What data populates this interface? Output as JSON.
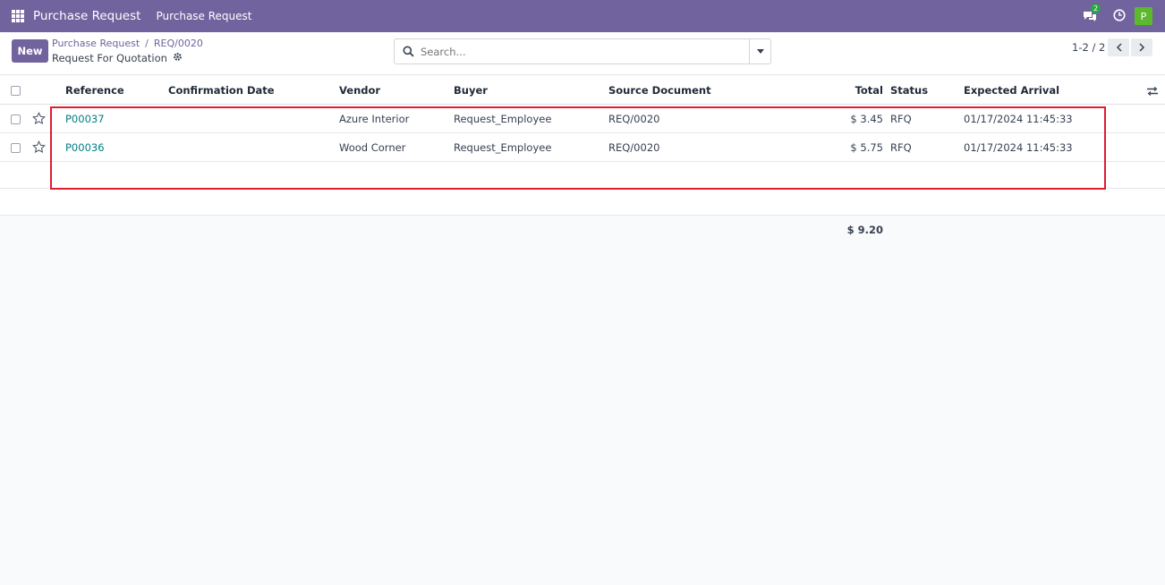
{
  "navbar": {
    "brand": "Purchase Request",
    "menu_item": "Purchase Request",
    "chat_badge": "2",
    "avatar_letter": "P"
  },
  "control": {
    "new_label": "New",
    "breadcrumb": [
      "Purchase Request",
      "REQ/0020"
    ],
    "subtitle": "Request For Quotation",
    "search_placeholder": "Search...",
    "pager": "1-2 / 2"
  },
  "table": {
    "headers": {
      "reference": "Reference",
      "confirmation_date": "Confirmation Date",
      "vendor": "Vendor",
      "buyer": "Buyer",
      "source_document": "Source Document",
      "total": "Total",
      "status": "Status",
      "expected_arrival": "Expected Arrival"
    },
    "rows": [
      {
        "reference": "P00037",
        "confirmation_date": "",
        "vendor": "Azure Interior",
        "buyer": "Request_Employee",
        "source_document": "REQ/0020",
        "total": "$ 3.45",
        "status": "RFQ",
        "expected_arrival": "01/17/2024 11:45:33"
      },
      {
        "reference": "P00036",
        "confirmation_date": "",
        "vendor": "Wood Corner",
        "buyer": "Request_Employee",
        "source_document": "REQ/0020",
        "total": "$ 5.75",
        "status": "RFQ",
        "expected_arrival": "01/17/2024 11:45:33"
      }
    ],
    "sum_total": "$ 9.20"
  },
  "colors": {
    "brand": "#71639e",
    "link": "#017e84",
    "highlight": "#e11d2e"
  }
}
